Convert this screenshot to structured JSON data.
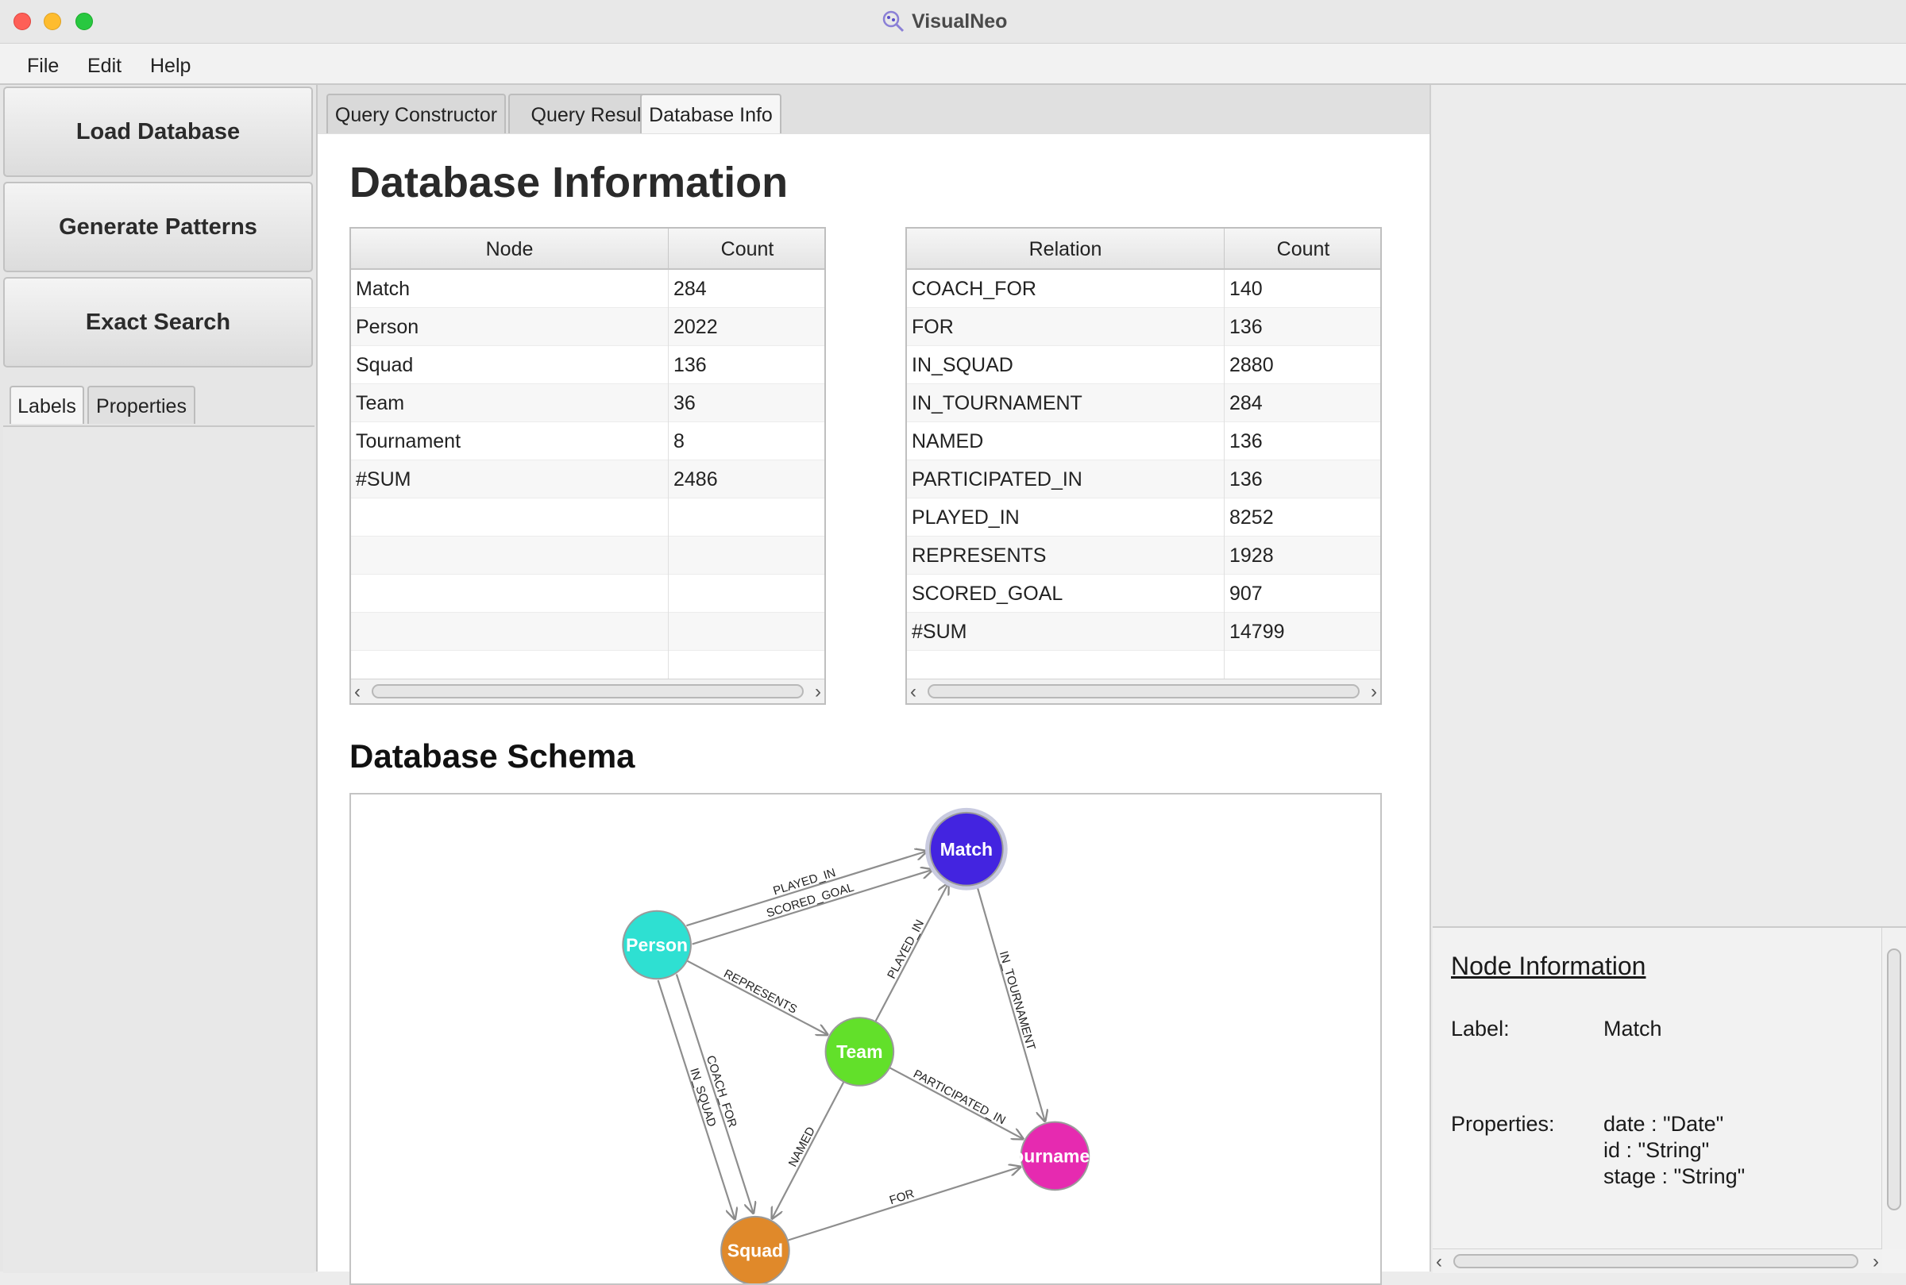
{
  "window": {
    "title": "VisualNeo"
  },
  "menu": [
    "File",
    "Edit",
    "Help"
  ],
  "left": {
    "buttons": [
      "Load Database",
      "Generate Patterns",
      "Exact Search"
    ],
    "tabs": [
      "Labels",
      "Properties"
    ]
  },
  "main_tabs": [
    "Query Constructor",
    "Query Result",
    "Database Info"
  ],
  "content": {
    "title": "Database Information",
    "schema_title": "Database Schema"
  },
  "node_table": {
    "headers": [
      "Node",
      "Count"
    ],
    "rows": [
      [
        "Match",
        "284"
      ],
      [
        "Person",
        "2022"
      ],
      [
        "Squad",
        "136"
      ],
      [
        "Team",
        "36"
      ],
      [
        "Tournament",
        "8"
      ],
      [
        "#SUM",
        "2486"
      ]
    ]
  },
  "relation_table": {
    "headers": [
      "Relation",
      "Count"
    ],
    "rows": [
      [
        "COACH_FOR",
        "140"
      ],
      [
        "FOR",
        "136"
      ],
      [
        "IN_SQUAD",
        "2880"
      ],
      [
        "IN_TOURNAMENT",
        "284"
      ],
      [
        "NAMED",
        "136"
      ],
      [
        "PARTICIPATED_IN",
        "136"
      ],
      [
        "PLAYED_IN",
        "8252"
      ],
      [
        "REPRESENTS",
        "1928"
      ],
      [
        "SCORED_GOAL",
        "907"
      ],
      [
        "#SUM",
        "14799"
      ]
    ]
  },
  "schema": {
    "nodes": [
      {
        "id": "match",
        "label": "Match",
        "color": "#4324e0"
      },
      {
        "id": "person",
        "label": "Person",
        "color": "#2ee0d2"
      },
      {
        "id": "team",
        "label": "Team",
        "color": "#62e02a"
      },
      {
        "id": "tournament",
        "label": "Tournament",
        "color": "#e62ab0"
      },
      {
        "id": "squad",
        "label": "Squad",
        "color": "#e0892a"
      }
    ],
    "edges": [
      {
        "from": "person",
        "to": "match",
        "label": "PLAYED_IN"
      },
      {
        "from": "person",
        "to": "match",
        "label": "SCORED_GOAL"
      },
      {
        "from": "person",
        "to": "team",
        "label": "REPRESENTS"
      },
      {
        "from": "person",
        "to": "squad",
        "label": "IN_SQUAD"
      },
      {
        "from": "person",
        "to": "squad",
        "label": "COACH_FOR"
      },
      {
        "from": "team",
        "to": "match",
        "label": "PLAYED_IN"
      },
      {
        "from": "match",
        "to": "tournament",
        "label": "IN_TOURNAMENT"
      },
      {
        "from": "team",
        "to": "tournament",
        "label": "PARTICIPATED_IN"
      },
      {
        "from": "team",
        "to": "squad",
        "label": "NAMED"
      },
      {
        "from": "squad",
        "to": "tournament",
        "label": "FOR"
      }
    ]
  },
  "node_info": {
    "title": "Node Information",
    "label_key": "Label:",
    "label_value": "Match",
    "properties_key": "Properties:",
    "properties": [
      "date : \"Date\"",
      "id : \"String\"",
      "stage : \"String\""
    ]
  },
  "colors": {
    "accent": "#4324e0",
    "window_bg": "#ececec"
  }
}
